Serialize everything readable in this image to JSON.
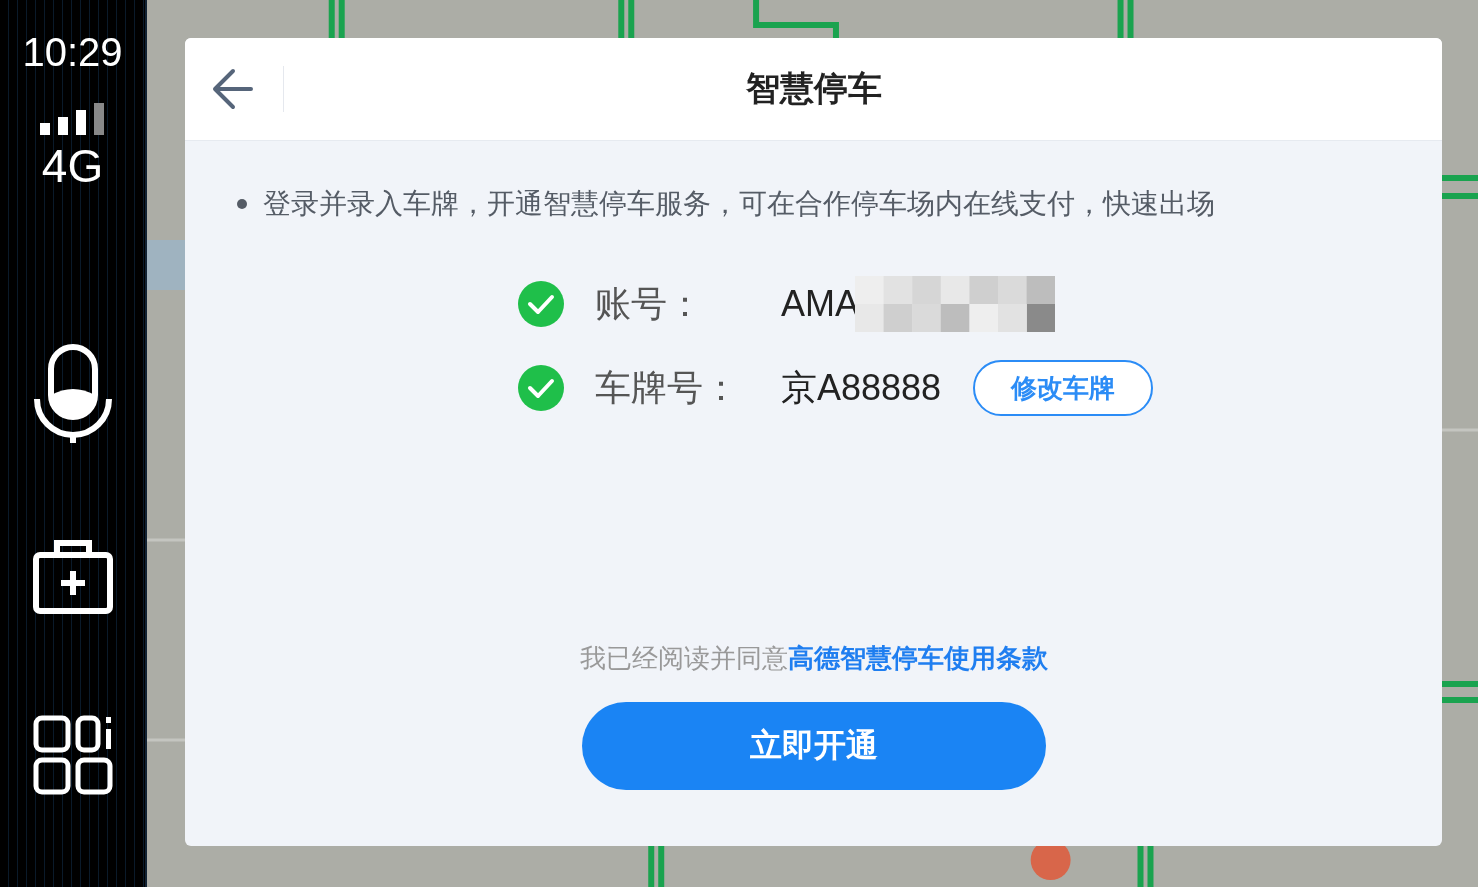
{
  "status": {
    "time": "10:29",
    "network": "4G"
  },
  "dock": [
    {
      "kind": "mic"
    },
    {
      "kind": "kit"
    },
    {
      "kind": "apps"
    }
  ],
  "dialog": {
    "title": "智慧停车",
    "notice": "登录并录入车牌，开通智慧停车服务，可在合作停车场内在线支付，快速出场",
    "fields": [
      {
        "label": "账号：",
        "value": "AMA",
        "checked": true,
        "redacted": true
      },
      {
        "label": "车牌号：",
        "value": "京A88888",
        "checked": true,
        "action": "修改车牌"
      }
    ],
    "agreement": {
      "text": "我已经阅读并同意",
      "link": "高德智慧停车使用条款"
    },
    "primary_button": "立即开通"
  }
}
